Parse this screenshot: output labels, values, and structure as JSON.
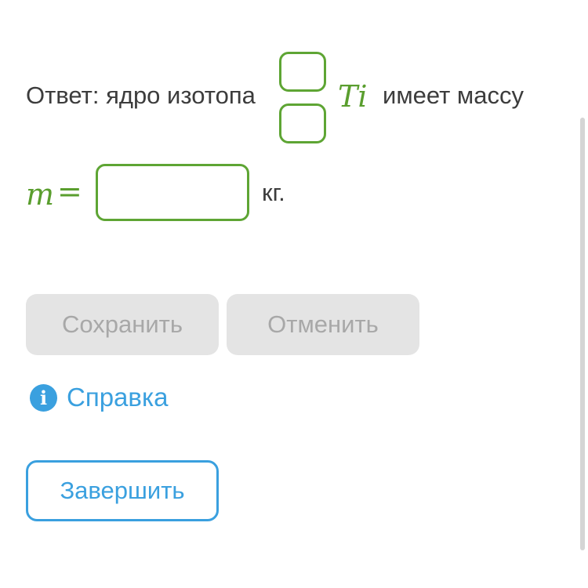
{
  "question": {
    "answer_prefix": "Ответ: ядро изотопа",
    "element_symbol": "Ti",
    "answer_suffix": "имеет массу",
    "mass_variable": "m",
    "equals_sign": "=",
    "unit": "кг.",
    "mass_number_value": "",
    "charge_number_value": "",
    "mass_value": ""
  },
  "buttons": {
    "save_label": "Сохранить",
    "cancel_label": "Отменить",
    "finish_label": "Завершить"
  },
  "help": {
    "icon_glyph": "i",
    "label": "Справка",
    "icon": "info-icon"
  },
  "colors": {
    "accent_green": "#5ea534",
    "accent_blue": "#3aa0df",
    "disabled_bg": "#e4e4e4",
    "disabled_text": "#a8a8a8"
  }
}
